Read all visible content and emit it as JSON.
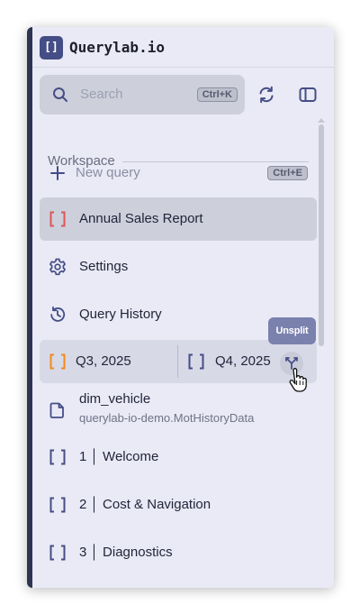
{
  "app": {
    "logo_glyph": "[]",
    "title": "Querylab.io"
  },
  "search": {
    "placeholder": "Search",
    "shortcut": "Ctrl+K"
  },
  "workspace": {
    "label": "Workspace"
  },
  "new_query": {
    "label": "New query",
    "shortcut": "Ctrl+E"
  },
  "items": [
    {
      "label": "Annual Sales Report",
      "icon": "bracket-icon",
      "icon_color": "#e05454",
      "active": true
    },
    {
      "label": "Settings",
      "icon": "gear-icon"
    },
    {
      "label": "Query History",
      "icon": "history-icon"
    }
  ],
  "split": {
    "left": {
      "label": "Q3, 2025",
      "icon_color": "#f08a1c"
    },
    "right": {
      "label": "Q4, 2025",
      "icon_color": "#454d86"
    },
    "tooltip": "Unsplit"
  },
  "file": {
    "label": "dim_vehicle",
    "sub": "querylab-io-demo.MotHistoryData"
  },
  "chapters": [
    {
      "label": "1 │ Welcome"
    },
    {
      "label": "2 │ Cost & Navigation"
    },
    {
      "label": "3 │ Diagnostics"
    }
  ],
  "colors": {
    "accent": "#454d86",
    "background": "#e9eaf5",
    "active_row": "#cdcfdb"
  }
}
